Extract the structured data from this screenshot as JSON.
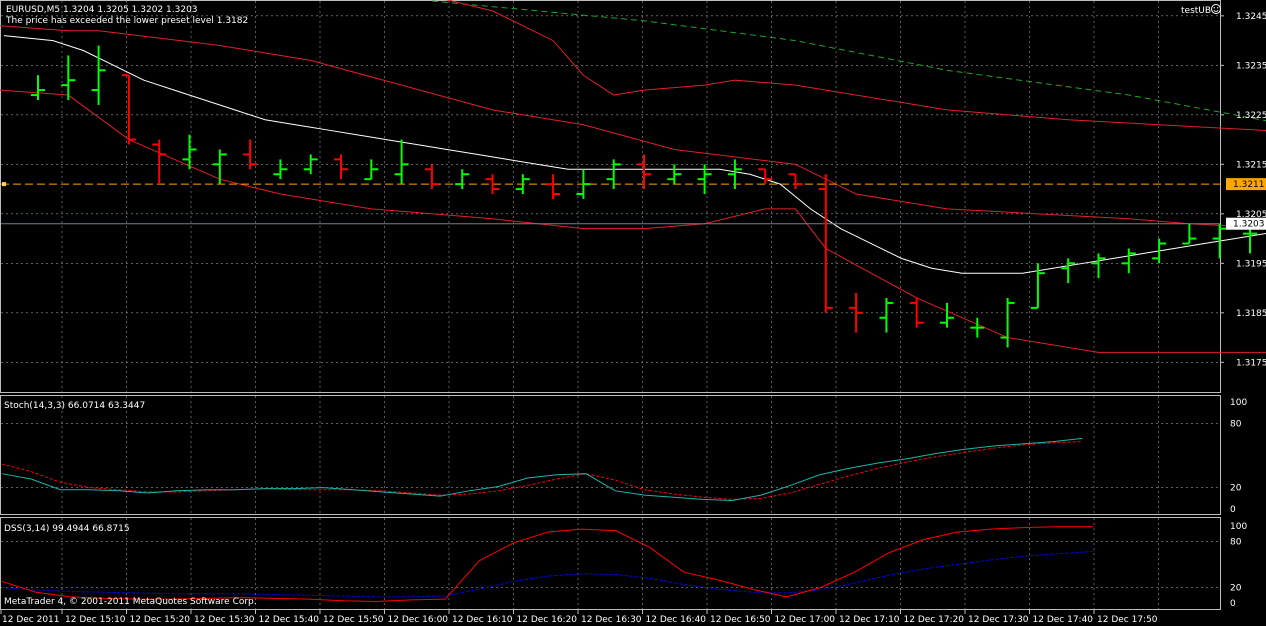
{
  "header": {
    "symbol_line": "EURUSD,M5  1.3204 1.3205 1.3202 1.3203",
    "alert_line": "The price has exceeded the lower preset level 1.3182",
    "indicator_name": "testUB"
  },
  "panes": {
    "stoch_label": "Stoch(14,3,3) 66.0714 63.3447",
    "dss_label": "DSS(3,14) 99.4944 66.8715",
    "copyright": "MetaTrader 4, © 2001-2011 MetaQuotes Software Corp."
  },
  "colors": {
    "background": "#000000",
    "grid": "#9a9a9a",
    "bull_bar": "#00ff00",
    "bear_bar": "#ff0000",
    "bands": "#e0202a",
    "ma_white": "#ffffff",
    "ma_green_dashed": "#1fa52a",
    "level_line": "#ffa500",
    "bid_line": "#708090",
    "stoch_main": "#20b2aa",
    "stoch_signal": "#ff0000",
    "dss_main": "#ff0000",
    "dss_signal": "#0000ff"
  },
  "chart_data": [
    {
      "type": "bar",
      "title": "EURUSD,M5",
      "y_ticks": [
        "1.3245",
        "1.3235",
        "1.3225",
        "1.3215",
        "1.3205",
        "1.3195",
        "1.3185",
        "1.3175"
      ],
      "ylim": [
        1.3169,
        1.3248
      ],
      "price_markers": [
        {
          "label": "1.3211",
          "value": 1.3211
        },
        {
          "label": "1.3203",
          "value": 1.3203
        }
      ],
      "x_ticks": [
        "12 Dec 2011",
        "12 Dec 15:10",
        "12 Dec 15:20",
        "12 Dec 15:30",
        "12 Dec 15:40",
        "12 Dec 15:50",
        "12 Dec 16:00",
        "12 Dec 16:10",
        "12 Dec 16:20",
        "12 Dec 16:30",
        "12 Dec 16:40",
        "12 Dec 16:50",
        "12 Dec 17:00",
        "12 Dec 17:10",
        "12 Dec 17:20",
        "12 Dec 17:30",
        "12 Dec 17:40",
        "12 Dec 17:50"
      ],
      "ohlc": [
        [
          1.3229,
          1.3233,
          1.3228,
          1.323
        ],
        [
          1.3231,
          1.3237,
          1.3228,
          1.3232
        ],
        [
          1.323,
          1.3239,
          1.3227,
          1.3234
        ],
        [
          1.3233,
          1.3233,
          1.3219,
          1.322
        ],
        [
          1.3219,
          1.322,
          1.3211,
          1.3217
        ],
        [
          1.3216,
          1.3221,
          1.3214,
          1.3218
        ],
        [
          1.3215,
          1.3218,
          1.3211,
          1.3217
        ],
        [
          1.3217,
          1.322,
          1.3214,
          1.3215
        ],
        [
          1.3213,
          1.3216,
          1.3212,
          1.3214
        ],
        [
          1.3214,
          1.3217,
          1.3213,
          1.3216
        ],
        [
          1.3216,
          1.3217,
          1.3212,
          1.3214
        ],
        [
          1.3212,
          1.3216,
          1.3212,
          1.3214
        ],
        [
          1.3213,
          1.322,
          1.3211,
          1.3215
        ],
        [
          1.3214,
          1.3215,
          1.321,
          1.3211
        ],
        [
          1.3211,
          1.3214,
          1.321,
          1.3213
        ],
        [
          1.3212,
          1.3213,
          1.3209,
          1.321
        ],
        [
          1.321,
          1.3213,
          1.3209,
          1.3212
        ],
        [
          1.3211,
          1.3213,
          1.3208,
          1.3209
        ],
        [
          1.3209,
          1.3214,
          1.3208,
          1.3211
        ],
        [
          1.3212,
          1.3216,
          1.321,
          1.3215
        ],
        [
          1.3215,
          1.3217,
          1.321,
          1.3213
        ],
        [
          1.3212,
          1.3215,
          1.3211,
          1.3213
        ],
        [
          1.3212,
          1.3215,
          1.3209,
          1.3213
        ],
        [
          1.3213,
          1.3216,
          1.321,
          1.3214
        ],
        [
          1.3214,
          1.3214,
          1.3211,
          1.3212
        ],
        [
          1.3213,
          1.3213,
          1.321,
          1.3211
        ],
        [
          1.321,
          1.3213,
          1.3185,
          1.3186
        ],
        [
          1.3186,
          1.3189,
          1.3181,
          1.3185
        ],
        [
          1.3184,
          1.3188,
          1.3181,
          1.3187
        ],
        [
          1.3187,
          1.3188,
          1.3182,
          1.3183
        ],
        [
          1.3183,
          1.3187,
          1.3182,
          1.3184
        ],
        [
          1.3182,
          1.3184,
          1.318,
          1.3182
        ],
        [
          1.318,
          1.3188,
          1.3178,
          1.3187
        ],
        [
          1.3186,
          1.3195,
          1.3186,
          1.3193
        ],
        [
          1.3194,
          1.3196,
          1.3191,
          1.3195
        ],
        [
          1.3195,
          1.3197,
          1.3192,
          1.3196
        ],
        [
          1.3195,
          1.3198,
          1.3193,
          1.3197
        ],
        [
          1.3196,
          1.32,
          1.3195,
          1.3199
        ],
        [
          1.3199,
          1.3203,
          1.3199,
          1.32
        ],
        [
          1.32,
          1.3203,
          1.3196,
          1.3202
        ],
        [
          1.3201,
          1.3202,
          1.3197,
          1.3201
        ],
        [
          1.3201,
          1.3203,
          1.32,
          1.3202
        ],
        [
          1.3204,
          1.3205,
          1.3202,
          1.3203
        ]
      ],
      "ma_white": [
        1.3241,
        1.324,
        1.3238,
        1.3235,
        1.3232,
        1.323,
        1.3228,
        1.3226,
        1.3224,
        1.3223,
        1.3222,
        1.3221,
        1.322,
        1.3219,
        1.3218,
        1.3217,
        1.3216,
        1.3215,
        1.3214,
        1.3214,
        1.3214,
        1.3214,
        1.3214,
        1.3214,
        1.3213,
        1.3211,
        1.3206,
        1.3202,
        1.3199,
        1.3196,
        1.3194,
        1.3193,
        1.3193,
        1.3193,
        1.3194,
        1.3195,
        1.3196,
        1.3197,
        1.3198,
        1.3199,
        1.32,
        1.3201,
        1.3201
      ],
      "ma_green_dashed": [
        [
          13,
          1.3248
        ],
        [
          20,
          1.3244
        ],
        [
          25,
          1.324
        ],
        [
          30,
          1.3234
        ],
        [
          36,
          1.3229
        ],
        [
          43,
          1.3221
        ]
      ],
      "band_upper": [
        [
          0,
          1.3243
        ],
        [
          1,
          1.3242
        ],
        [
          2,
          1.3242
        ],
        [
          6,
          1.3239
        ],
        [
          9,
          1.3236
        ],
        [
          12,
          1.3231
        ],
        [
          15,
          1.3226
        ],
        [
          18,
          1.3223
        ],
        [
          21,
          1.3218
        ],
        [
          25,
          1.3215
        ],
        [
          27,
          1.3209
        ],
        [
          29,
          1.3207
        ],
        [
          30,
          1.3206
        ],
        [
          33,
          1.3205
        ],
        [
          36,
          1.3204
        ],
        [
          38,
          1.3203
        ],
        [
          41,
          1.3202
        ],
        [
          43,
          1.3202
        ]
      ],
      "band_lower": [
        [
          0,
          1.323
        ],
        [
          1,
          1.3229
        ],
        [
          3,
          1.322
        ],
        [
          6,
          1.3212
        ],
        [
          8,
          1.3209
        ],
        [
          11,
          1.3206
        ],
        [
          15,
          1.3204
        ],
        [
          18,
          1.3202
        ],
        [
          20,
          1.3202
        ],
        [
          22,
          1.3203
        ],
        [
          24,
          1.3206
        ],
        [
          25,
          1.3206
        ],
        [
          26,
          1.3198
        ],
        [
          29,
          1.3188
        ],
        [
          32,
          1.318
        ],
        [
          35,
          1.3177
        ],
        [
          37,
          1.3177
        ],
        [
          41,
          1.3177
        ],
        [
          43,
          1.3177
        ]
      ],
      "band_outer_upper": [
        [
          10,
          1.3251
        ],
        [
          13,
          1.3249
        ],
        [
          15,
          1.3246
        ],
        [
          17,
          1.324
        ],
        [
          18,
          1.3233
        ],
        [
          19,
          1.3229
        ],
        [
          20,
          1.323
        ],
        [
          22,
          1.3231
        ],
        [
          23,
          1.3232
        ],
        [
          25,
          1.3231
        ],
        [
          30,
          1.3226
        ],
        [
          34,
          1.3224
        ],
        [
          43,
          1.3221
        ]
      ],
      "price_levels": [
        1.3211,
        1.3203
      ]
    },
    {
      "type": "line",
      "title": "Stoch(14,3,3)",
      "y_ticks": [
        "100",
        "80",
        "20",
        "0"
      ],
      "ylim": [
        0,
        100
      ],
      "series": [
        {
          "name": "Stoch main",
          "values": [
            33,
            28,
            18,
            18,
            17,
            15,
            17,
            18,
            18,
            19,
            19,
            20,
            18,
            16,
            14,
            12,
            17,
            21,
            29,
            32,
            33,
            17,
            13,
            11,
            9,
            8,
            13,
            22,
            32,
            38,
            43,
            47,
            52,
            56,
            59,
            61,
            63,
            66
          ]
        },
        {
          "name": "Stoch signal",
          "values": [
            42,
            35,
            25,
            20,
            18,
            16,
            16,
            17,
            18,
            19,
            18,
            18,
            18,
            17,
            15,
            13,
            14,
            17,
            22,
            28,
            33,
            27,
            18,
            14,
            11,
            9,
            10,
            15,
            23,
            31,
            38,
            44,
            49,
            53,
            57,
            60,
            62,
            63
          ]
        }
      ]
    },
    {
      "type": "line",
      "title": "DSS(3,14)",
      "y_ticks": [
        "100",
        "80",
        "20",
        "0"
      ],
      "ylim": [
        0,
        100
      ],
      "series": [
        {
          "name": "DSS main",
          "values": [
            28,
            14,
            8,
            6,
            5,
            5,
            6,
            7,
            6,
            5,
            3,
            2,
            4,
            5,
            55,
            78,
            92,
            96,
            94,
            72,
            40,
            30,
            18,
            8,
            20,
            40,
            65,
            82,
            92,
            96,
            98,
            99,
            99
          ]
        },
        {
          "name": "DSS signal",
          "values": [
            20,
            17,
            15,
            14,
            13,
            12,
            12,
            12,
            11,
            10,
            9,
            8,
            8,
            9,
            18,
            28,
            35,
            38,
            37,
            32,
            24,
            18,
            14,
            13,
            17,
            26,
            36,
            44,
            50,
            56,
            61,
            64,
            67
          ]
        }
      ]
    }
  ]
}
